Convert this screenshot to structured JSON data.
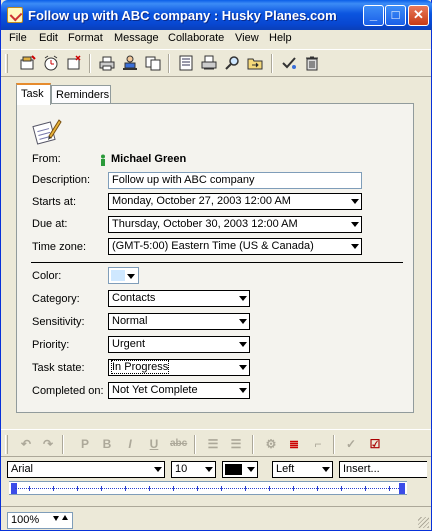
{
  "window": {
    "title": "Follow up with ABC company : Husky Planes.com",
    "min_label": "_",
    "max_label": "□",
    "close_label": "✕"
  },
  "menu": [
    "File",
    "Edit",
    "Format",
    "Message",
    "Collaborate",
    "View",
    "Help"
  ],
  "toolbar_icons": [
    "new-task-icon",
    "reminder-clock-icon",
    "delete-task-icon",
    "print-icon",
    "assign-icon",
    "copy-icon",
    "notes-icon",
    "print-preview-icon",
    "find-icon",
    "move-icon",
    "mark-done-icon",
    "trash-icon"
  ],
  "tabs": [
    "Task",
    "Reminders"
  ],
  "form": {
    "from_label": "From:",
    "from_value": "Michael Green",
    "description_label": "Description:",
    "description_value": "Follow up with ABC company",
    "starts_label": "Starts at:",
    "starts_value": "Monday, October 27, 2003 12:00 AM",
    "due_label": "Due at:",
    "due_value": "Thursday, October 30, 2003 12:00 AM",
    "timezone_label": "Time zone:",
    "timezone_value": "(GMT-5:00) Eastern Time (US & Canada)",
    "color_label": "Color:",
    "color_value": "#cfe8ff",
    "category_label": "Category:",
    "category_value": "Contacts",
    "sensitivity_label": "Sensitivity:",
    "sensitivity_value": "Normal",
    "priority_label": "Priority:",
    "priority_value": "Urgent",
    "taskstate_label": "Task state:",
    "taskstate_value": "In Progress",
    "completed_label": "Completed on:",
    "completed_value": "Not Yet Complete"
  },
  "format_toolbar": {
    "font": "Arial",
    "size": "10",
    "align": "Left",
    "insert": "Insert...",
    "bold": "B",
    "italic": "I",
    "underline": "U"
  },
  "status": {
    "zoom": "100%"
  }
}
